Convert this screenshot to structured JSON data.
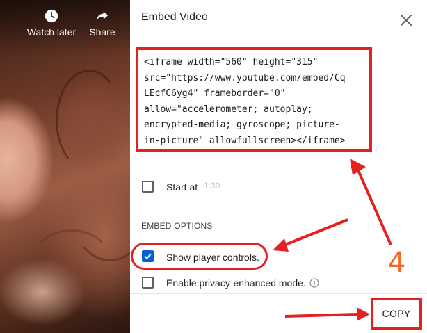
{
  "video": {
    "watch_later_label": "Watch later",
    "share_label": "Share",
    "watch_later_icon": "clock-icon",
    "share_icon": "share-arrow-icon"
  },
  "dialog": {
    "title": "Embed Video",
    "close_icon": "close-icon",
    "embed_code": "<iframe width=\"560\" height=\"315\"\nsrc=\"https://www.youtube.com/embed/Cq\nLEcfC6yg4\" frameborder=\"0\"\nallow=\"accelerometer; autoplay;\nencrypted-media; gyroscope; picture-\nin-picture\" allowfullscreen></iframe>",
    "start_at_label": "Start at",
    "start_at_value": "1:30",
    "start_at_checked": false,
    "embed_options_heading": "EMBED OPTIONS",
    "show_controls_label": "Show player controls.",
    "show_controls_checked": true,
    "privacy_label": "Enable privacy-enhanced mode.",
    "privacy_checked": false,
    "copy_label": "COPY"
  },
  "annotations": {
    "step_number": "4",
    "highlight_color": "#e5201f",
    "step_color": "#f26b21"
  },
  "colors": {
    "checkbox_checked": "#065fd4"
  }
}
